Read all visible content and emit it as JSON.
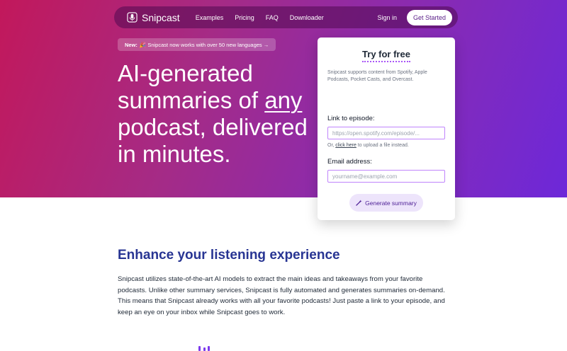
{
  "nav": {
    "brand": "Snipcast",
    "links": [
      "Examples",
      "Pricing",
      "FAQ",
      "Downloader"
    ],
    "signin": "Sign in",
    "cta": "Get Started"
  },
  "announcement": {
    "badge": "New:",
    "text": "🎉 Snipcast now works with over 50 new languages →"
  },
  "hero": {
    "line1": "AI-generated",
    "line2_pre": "summaries of ",
    "line2_em": "any",
    "line3": "podcast, delivered",
    "line4": "in minutes."
  },
  "form": {
    "title": "Try for free",
    "description": "Snipcast supports content from Spotify, Apple Podcasts, Pocket Casts, and Overcast.",
    "episode_label": "Link to episode:",
    "episode_placeholder": "https://open.spotify.com/episode/...",
    "upload_pre": "Or, ",
    "upload_link": "click here",
    "upload_post": " to upload a file instead.",
    "email_label": "Email address:",
    "email_placeholder": "yourname@example.com",
    "submit": "Generate summary"
  },
  "section": {
    "title": "Enhance your listening experience",
    "body": "Snipcast utilizes state-of-the-art AI models to extract the main ideas and takeaways from your favorite podcasts. Unlike other summary services, Snipcast is fully automated and generates summaries on-demand. This means that Snipcast already works with all your favorite podcasts! Just paste a link to your episode, and keep an eye on your inbox while Snipcast goes to work."
  },
  "colors": {
    "hero_start": "#c2185b",
    "hero_end": "#6d28d9",
    "heading": "#283593",
    "accent": "#a855f7"
  }
}
